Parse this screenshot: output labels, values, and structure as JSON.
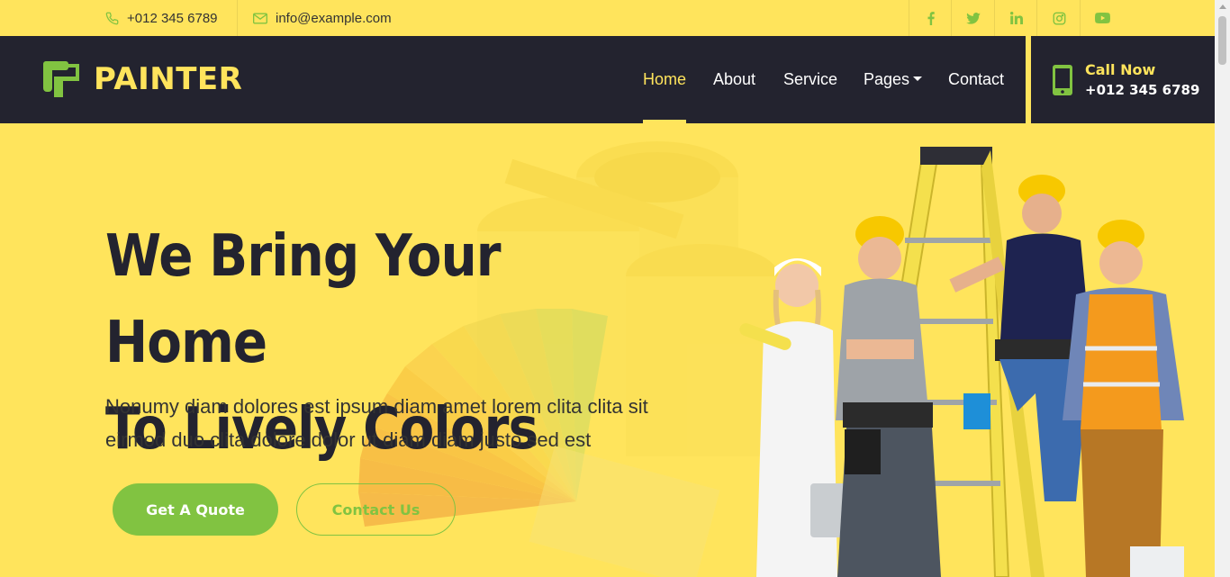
{
  "topbar": {
    "phone": "+012 345 6789",
    "email": "info@example.com",
    "social": [
      "facebook-icon",
      "twitter-icon",
      "linkedin-icon",
      "instagram-icon",
      "youtube-icon"
    ]
  },
  "brand": {
    "name": "PAINTER"
  },
  "nav": {
    "items": [
      {
        "label": "Home",
        "active": true
      },
      {
        "label": "About"
      },
      {
        "label": "Service"
      },
      {
        "label": "Pages",
        "dropdown": true
      },
      {
        "label": "Contact"
      }
    ]
  },
  "call": {
    "title": "Call Now",
    "number": "+012 345 6789"
  },
  "hero": {
    "title_line1": "We Bring Your Home",
    "title_line2": "To Lively Colors",
    "subtitle_line1": "Nonumy diam dolores est ipsum diam amet lorem clita clita sit",
    "subtitle_line2": "eirmod duo clita dolore dolor ut diam diam justo sed est",
    "primary_button": "Get A Quote",
    "secondary_button": "Contact Us"
  },
  "colors": {
    "accent_yellow": "#FFE45C",
    "accent_green": "#81C341",
    "navbar_bg": "#23232F"
  }
}
